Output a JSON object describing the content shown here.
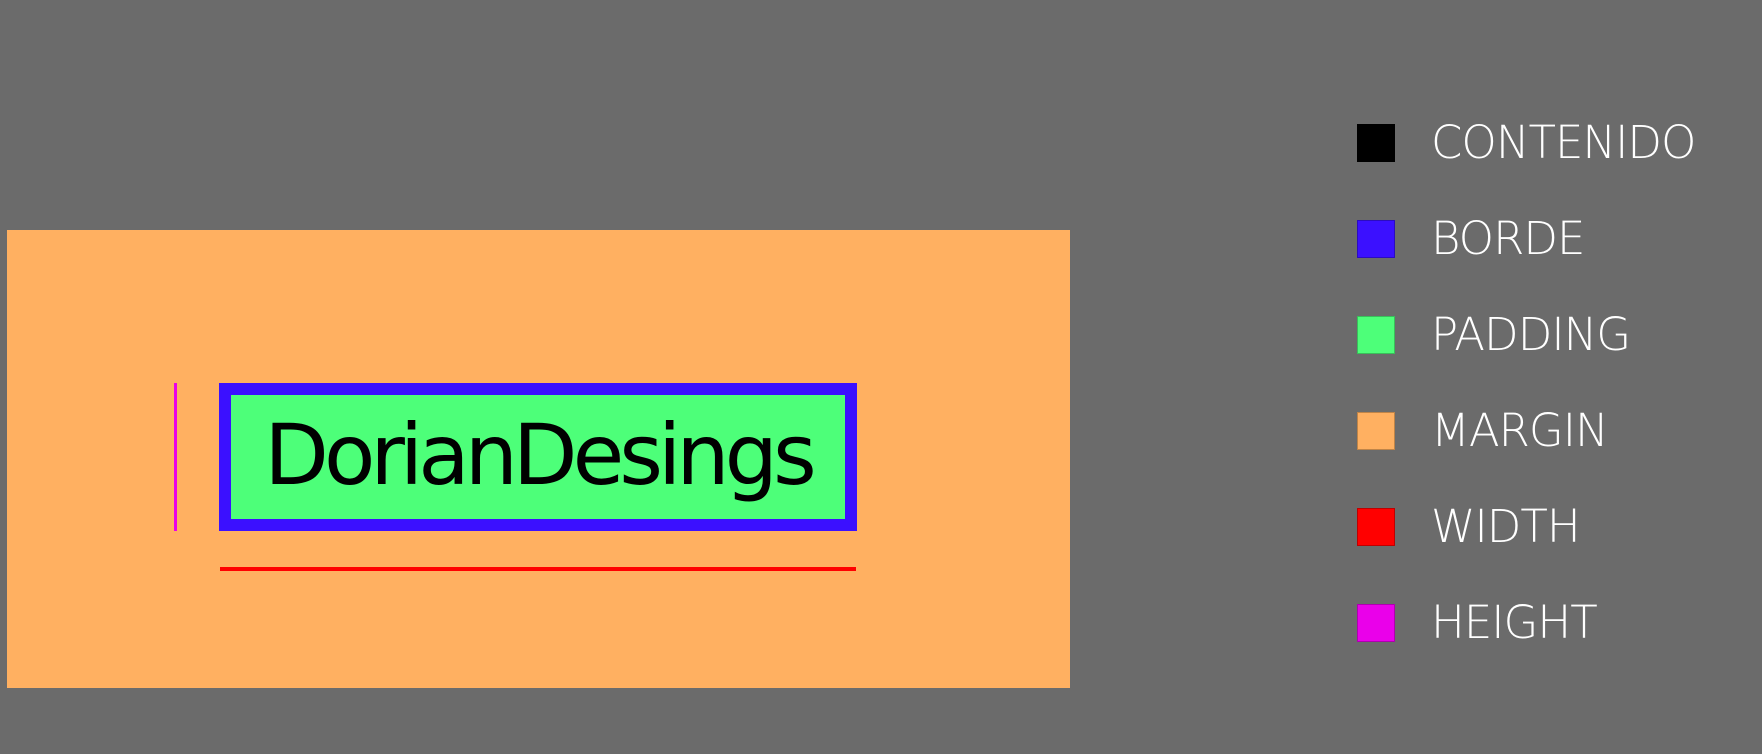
{
  "diagram": {
    "content_text": "DorianDesings",
    "colors": {
      "background": "#6b6b6b",
      "margin": "#ffb061",
      "border": "#3b10ff",
      "padding": "#4dff79",
      "content": "#000000",
      "width": "#ff0000",
      "height": "#ea00ea"
    }
  },
  "legend": {
    "items": [
      {
        "label": "CONTENIDO",
        "color": "#000000"
      },
      {
        "label": "BORDE",
        "color": "#3b10ff"
      },
      {
        "label": "PADDING",
        "color": "#4dff79"
      },
      {
        "label": "MARGIN",
        "color": "#ffb061"
      },
      {
        "label": "WIDTH",
        "color": "#ff0000"
      },
      {
        "label": "HEIGHT",
        "color": "#ea00ea"
      }
    ]
  }
}
